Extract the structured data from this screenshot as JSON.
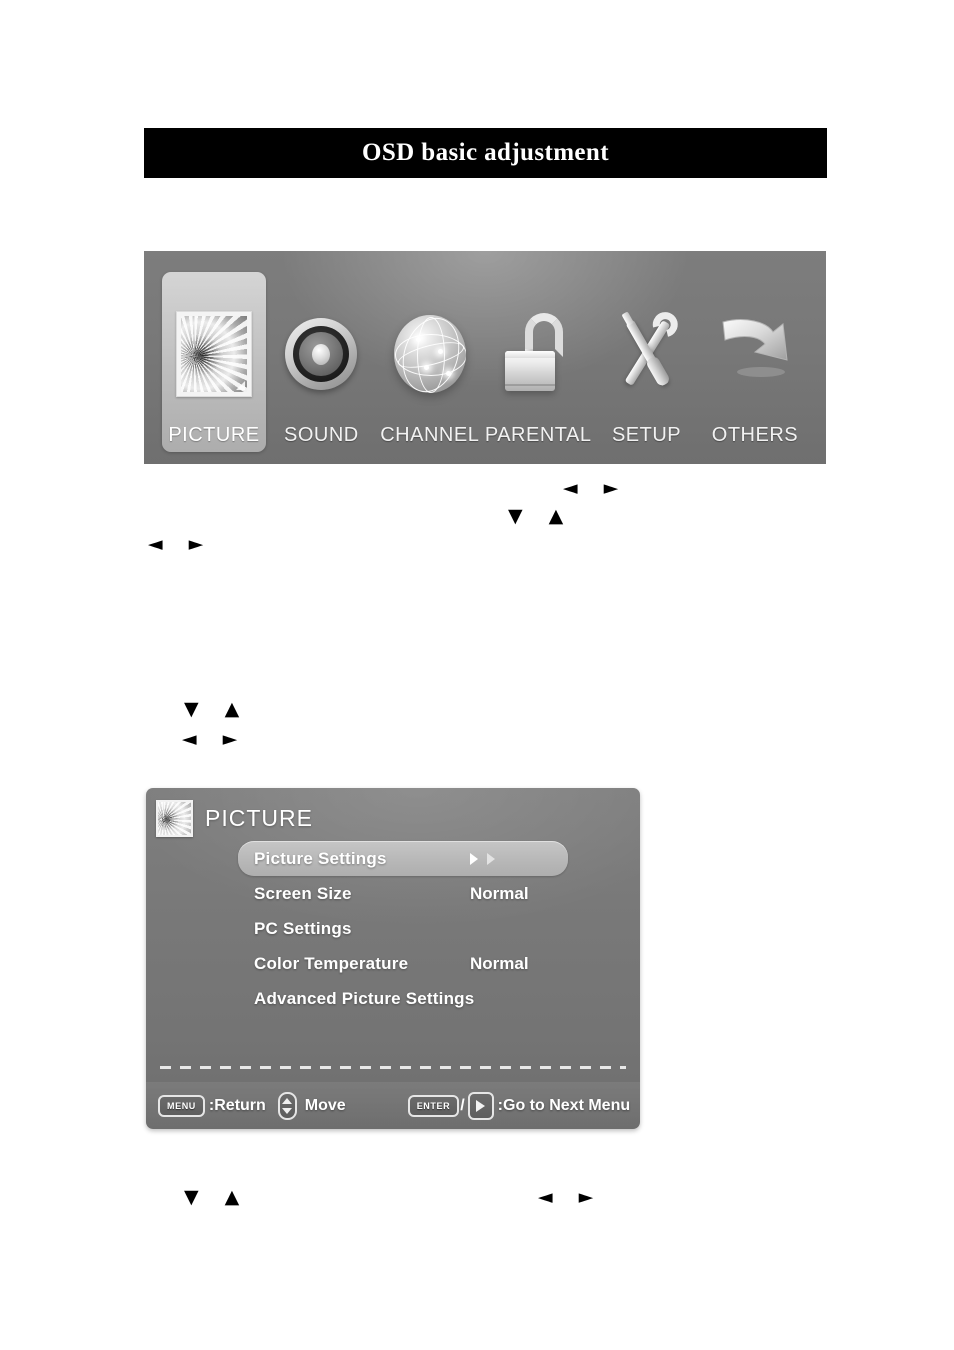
{
  "page": {
    "title": "OSD basic adjustment"
  },
  "osd_main_menu": {
    "items": [
      {
        "label": "PICTURE",
        "icon": "picture-photo-icon",
        "selected": true
      },
      {
        "label": "SOUND",
        "icon": "speaker-icon",
        "selected": false
      },
      {
        "label": "CHANNEL",
        "icon": "globe-icon",
        "selected": false
      },
      {
        "label": "PARENTAL",
        "icon": "open-padlock-icon",
        "selected": false
      },
      {
        "label": "SETUP",
        "icon": "wrench-screwdriver-icon",
        "selected": false
      },
      {
        "label": "OTHERS",
        "icon": "bent-arrow-icon",
        "selected": false
      }
    ]
  },
  "nav_glyphs": {
    "g1": "◄  ►",
    "g2": "▼  ▲",
    "g3": "◄  ►",
    "g4": "▼  ▲",
    "g5": "◄  ►",
    "g6": "▼  ▲",
    "g7": "◄  ►"
  },
  "picture_submenu": {
    "title": "PICTURE",
    "icon": "picture-photo-icon",
    "rows": [
      {
        "label": "Picture Settings",
        "value": "",
        "highlighted": true,
        "arrows": true
      },
      {
        "label": "Screen Size",
        "value": "Normal",
        "highlighted": false,
        "arrows": false
      },
      {
        "label": "PC Settings",
        "value": "",
        "highlighted": false,
        "arrows": false
      },
      {
        "label": "Color Temperature",
        "value": "Normal",
        "highlighted": false,
        "arrows": false
      },
      {
        "label": "Advanced Picture Settings",
        "value": "",
        "highlighted": false,
        "arrows": false
      }
    ],
    "footer": {
      "menu_key": "MENU",
      "return_text": ":Return",
      "move_text": "Move",
      "enter_key": "ENTER",
      "slash": "/",
      "next_menu_text": ":Go to Next Menu"
    }
  },
  "colors": {
    "title_bar_bg": "#000000",
    "title_text": "#ffffff",
    "osd_panel_bg": "#787878",
    "submenu_panel_bg": "#757575",
    "row_highlight": "#b9b9b9",
    "row_text": "#ffffff",
    "page_bg": "#ffffff"
  }
}
